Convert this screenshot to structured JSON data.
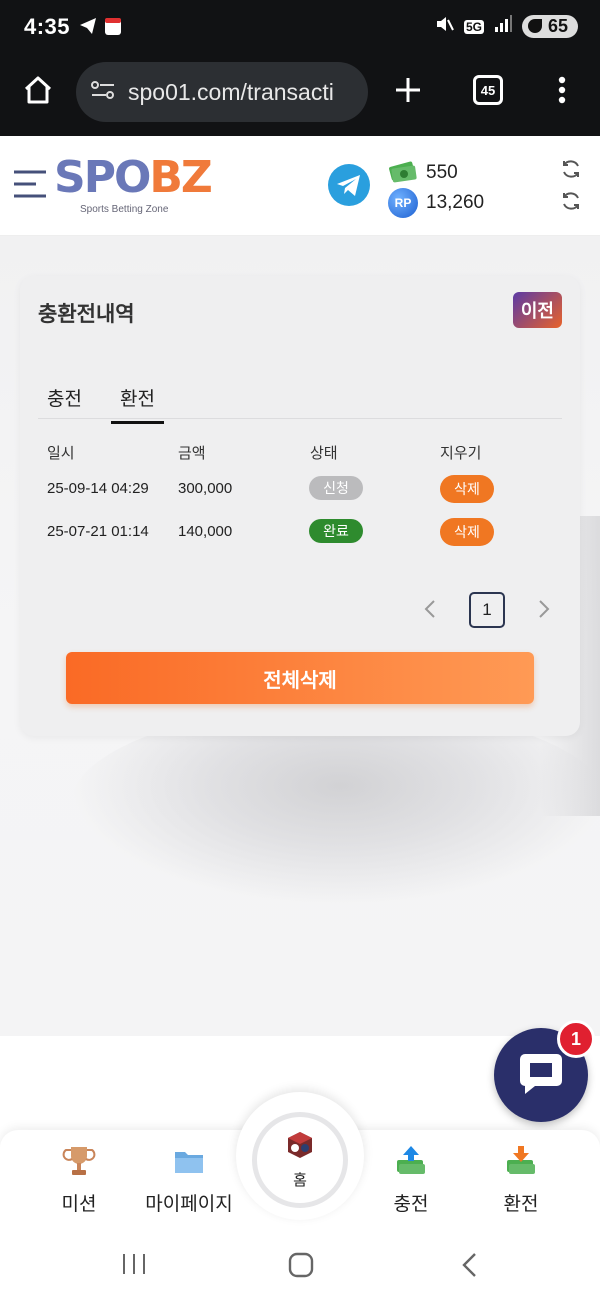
{
  "status_bar": {
    "time": "4:35",
    "network": "5G",
    "battery": "65"
  },
  "browser": {
    "url": "spo01.com/transacti",
    "tab_count": "45"
  },
  "header": {
    "logo_main_a": "SPO",
    "logo_main_b": "BZ",
    "logo_sub": "Sports Betting Zone",
    "balance_money": "550",
    "balance_rp": "13,260",
    "rp_icon_text": "RP"
  },
  "card": {
    "title": "충환전내역",
    "prev_label": "이전",
    "tabs": [
      "충전",
      "환전"
    ],
    "active_tab": 1,
    "columns": [
      "일시",
      "금액",
      "상태",
      "지우기"
    ],
    "rows": [
      {
        "date": "25-09-14 04:29",
        "amount": "300,000",
        "status": "신청",
        "status_color": "#bbbbbd",
        "action": "삭제"
      },
      {
        "date": "25-07-21 01:14",
        "amount": "140,000",
        "status": "완료",
        "status_color": "#2e8b2e",
        "action": "삭제"
      }
    ],
    "page": "1",
    "delete_all_label": "전체삭제"
  },
  "chat": {
    "badge": "1"
  },
  "bottom_nav": {
    "mission": "미션",
    "mypage": "마이페이지",
    "home": "홈",
    "deposit": "충전",
    "withdraw": "환전"
  },
  "colors": {
    "accent": "#f07722",
    "complete": "#2e8b2e",
    "pending": "#bbbbbd",
    "chat": "#2a2f6a"
  }
}
